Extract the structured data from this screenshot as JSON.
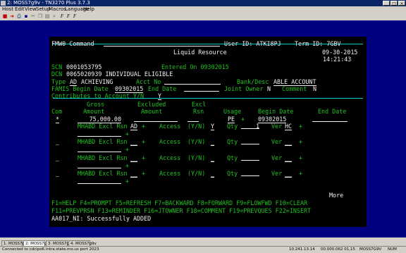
{
  "window": {
    "title": "2: MOSS7g9v - TN3270 Plus 3.7.3"
  },
  "menu": [
    "Host",
    "Edit",
    "View",
    "Setup",
    "Macros",
    "Language",
    "Help"
  ],
  "terminal": {
    "header": {
      "left": "FMW0 Command",
      "user": "User ID: ATKI8PJ",
      "term": "Term ID: 7GBV",
      "title": "Liquid Resource",
      "date": "09-30-2015",
      "time": "14:21:43"
    },
    "scn": {
      "label": "SCN",
      "value": "0001053795",
      "entered": "Entered On 09302015"
    },
    "dcn": {
      "label": "DCN",
      "value": "0065020939 INDIVIDUAL ELIGIBLE"
    },
    "type": {
      "label": "Type",
      "code": "AD",
      "desc": "ACHIEVING",
      "acct_label": "Acct No",
      "bank_label": "Bank/Desc",
      "bank_value": "ABLE ACCOUNT"
    },
    "famis": {
      "label": "FAMIS Begin Date",
      "value": "09302015",
      "end_label": "End Date",
      "joint_label": "Joint Owner",
      "joint_value": "N",
      "comment_label": "Comment",
      "comment_value": "N"
    },
    "contrib": {
      "label": "Contributes to Account Y/N",
      "value": "Y"
    },
    "cols": {
      "gross": "Gross",
      "excluded": "Excluded",
      "excl": "Excl",
      "com": "Com",
      "amount": "Amount",
      "amount2": "Amount",
      "rsn": "Rsn",
      "usage": "Usage",
      "begin": "Begin Date",
      "end": "End Date"
    },
    "row1": {
      "com": "*",
      "gross": "75,000.00",
      "usage": "PE",
      "plus": "+",
      "begin": "09302015"
    },
    "mhabd_rows": [
      {
        "label": "MHABD Excl Rsn",
        "code": "AD",
        "plus": "+",
        "access": "Access",
        "yn": "(Y/N)",
        "val": "Y",
        "qty_label": "Qty",
        "qty": "1",
        "ver_label": "Ver",
        "ver": "HC",
        "plus2": "+"
      },
      {
        "label": "MHABD Excl Rsn",
        "code": "__",
        "plus": "+",
        "access": "Access",
        "yn": "(Y/N)",
        "val": "_",
        "qty_label": "Qty",
        "qty": "",
        "ver_label": "Ver",
        "ver": "__",
        "plus2": "+"
      },
      {
        "label": "MHABD Excl Rsn",
        "code": "__",
        "plus": "+",
        "access": "Access",
        "yn": "(Y/N)",
        "val": "_",
        "qty_label": "Qty",
        "qty": "",
        "ver_label": "Ver",
        "ver": "__",
        "plus2": "+"
      },
      {
        "label": "MHABD Excl Rsn",
        "code": "__",
        "plus": "+",
        "access": "Access",
        "yn": "(Y/N)",
        "val": "_",
        "qty_label": "Qty",
        "qty": "",
        "ver_label": "Ver",
        "ver": "__",
        "plus2": "+"
      }
    ],
    "more": "More",
    "pf1": "F1=HELP F4=PROMPT F5=REFRESH F7=BACKWARD F8=FORWARD F9=FLOWFWD F10=CLEAR",
    "pf2": "F11=PREVPRSN F13=REMINDER F16=JTOWNER F18=COMMENT F19=PREVQUES F22=INSERT",
    "message": "AA017_NI: Successfully ADDED"
  },
  "tabs": [
    "1. MOSS7g9v",
    "2: MOSS7g9v",
    "3. MOSS7g9v",
    "4. MOSS7g9v"
  ],
  "status": {
    "left": "Connected to cdcipo6.intra.state.mo.us port 2023",
    "ip": "10.241.13.14",
    "pos": "00.000.062  01,15",
    "session": "MOSS7G9V",
    "num": "NUM"
  }
}
